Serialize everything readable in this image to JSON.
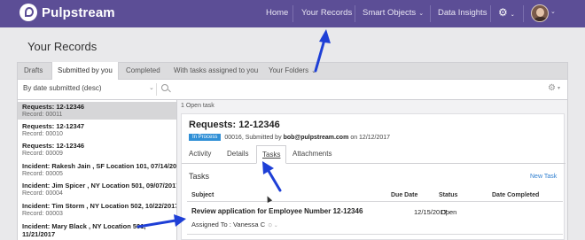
{
  "brand": {
    "name": "Pulpstream"
  },
  "nav": {
    "home": "Home",
    "your_records": "Your Records",
    "smart_objects": "Smart Objects",
    "data_insights": "Data Insights",
    "caret": "⌄",
    "gear": "⚙"
  },
  "page": {
    "title": "Your Records"
  },
  "record_tabs": {
    "drafts": "Drafts",
    "submitted": "Submitted by you",
    "completed": "Completed",
    "with_tasks": "With tasks assigned to you",
    "your_folders": "Your Folders",
    "folders_caret": "⌄"
  },
  "filter": {
    "sort": "By date submitted (desc)",
    "sort_caret": "⌄",
    "gear": "⚙",
    "gear_caret": "▾"
  },
  "records": [
    {
      "title": "Requests: 12-12346",
      "number": "Record: 00011"
    },
    {
      "title": "Requests: 12-12347",
      "number": "Record: 00010"
    },
    {
      "title": "Requests: 12-12346",
      "number": "Record: 00009"
    },
    {
      "title": "Incident: Rakesh Jain , SF Location 101, 07/14/2017",
      "number": "Record: 00005"
    },
    {
      "title": "Incident: Jim Spicer , NY Location 501, 09/07/2017",
      "number": "Record: 00004"
    },
    {
      "title": "Incident: Tim Storm , NY Location 502, 10/22/2017",
      "number": "Record: 00003"
    },
    {
      "title": "Incident: Mary Black , NY Location 501,",
      "title2": "11/21/2017"
    }
  ],
  "detail": {
    "open_task": "1 Open task",
    "title": "Requests: 12-12346",
    "status": "In Process",
    "meta_prefix": "00016, Submitted by",
    "submitter": "bob@pulpstream.com",
    "meta_suffix": "on 12/12/2017",
    "tabs": {
      "activity": "Activity",
      "details": "Details",
      "tasks": "Tasks",
      "attachments": "Attachments"
    },
    "tasks_heading": "Tasks",
    "new_task": "New Task",
    "columns": {
      "subject": "Subject",
      "due_date": "Due Date",
      "status": "Status",
      "date_completed": "Date Completed"
    },
    "task": {
      "subject": "Review application for Employee Number 12-12346",
      "due_date": "12/15/2017",
      "status": "Open",
      "assigned": "Assigned To : Vanessa C",
      "assigned_dots": "⊙ ⌄"
    }
  },
  "colors": {
    "nav_bg": "#5c4e96",
    "status_badge": "#2f8fd6",
    "annotation_arrow": "#1e3fd6",
    "link": "#2f7fd0"
  }
}
